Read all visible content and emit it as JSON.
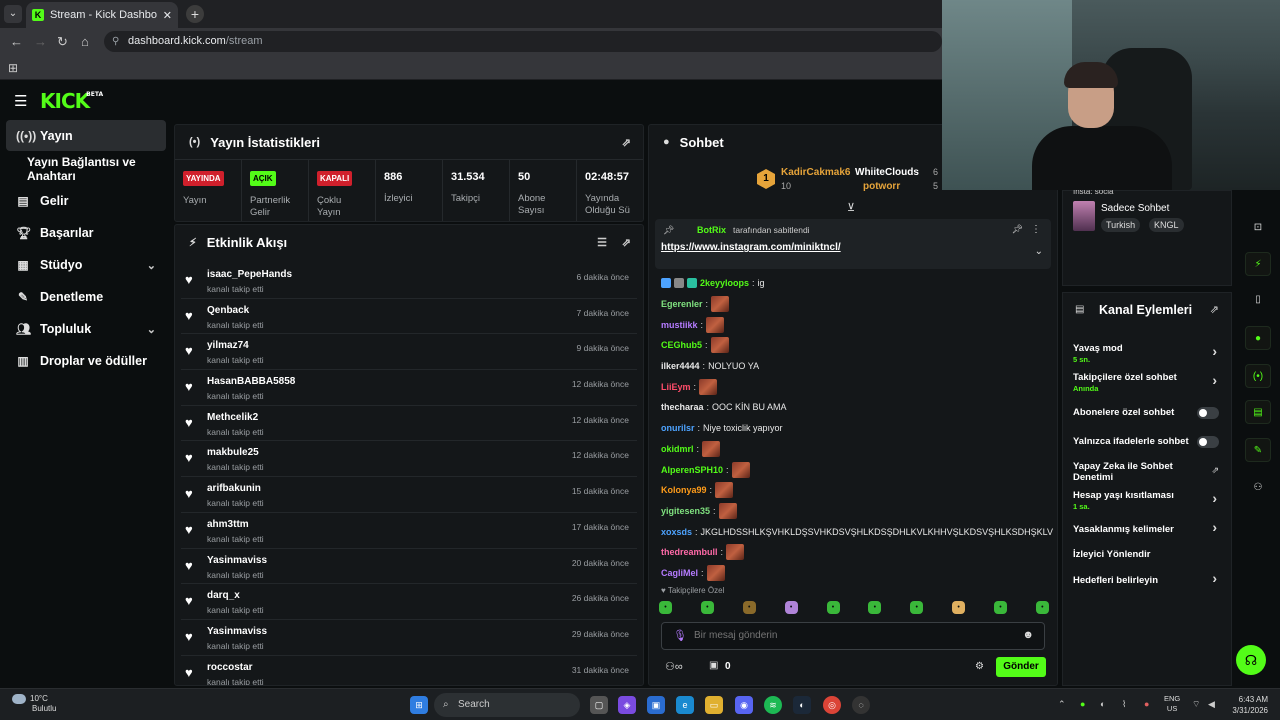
{
  "browser": {
    "tab_title": "Stream - Kick Dashboard",
    "url_host": "dashboard.kick.com",
    "url_path": "/stream"
  },
  "brand": {
    "logo": "KICK",
    "beta": "BETA"
  },
  "sidebar": {
    "items": [
      {
        "label": "Yayın",
        "icon": "broadcast-icon"
      },
      {
        "label": "Yayın Bağlantısı ve Anahtarı",
        "icon": ""
      },
      {
        "label": "Gelir",
        "icon": "revenue-icon"
      },
      {
        "label": "Başarılar",
        "icon": "trophy-icon"
      },
      {
        "label": "Stüdyo",
        "icon": "studio-icon"
      },
      {
        "label": "Denetleme",
        "icon": "wrench-icon"
      },
      {
        "label": "Topluluk",
        "icon": "community-icon"
      },
      {
        "label": "Droplar ve ödüller",
        "icon": "drops-icon"
      }
    ]
  },
  "stats_panel": {
    "title": "Yayın İstatistikleri",
    "stats": [
      {
        "badge": "YAYINDA",
        "label": "Yayın"
      },
      {
        "badge": "AÇIK",
        "label": "Partnerlik Gelir"
      },
      {
        "badge": "KAPALI",
        "label": "Çoklu Yayın"
      },
      {
        "value": "886",
        "label": "İzleyici"
      },
      {
        "value": "31.534",
        "label": "Takipçi"
      },
      {
        "value": "50",
        "label": "Abone Sayısı"
      },
      {
        "value": "02:48:57",
        "label": "Yayında Olduğu Sü"
      }
    ]
  },
  "event_panel": {
    "title": "Etkinlik Akışı",
    "events": [
      {
        "user": "isaac_PepeHands",
        "action": "kanalı takip etti",
        "time": "6 dakika önce"
      },
      {
        "user": "Qenback",
        "action": "kanalı takip etti",
        "time": "7 dakika önce"
      },
      {
        "user": "yilmaz74",
        "action": "kanalı takip etti",
        "time": "9 dakika önce"
      },
      {
        "user": "HasanBABBA5858",
        "action": "kanalı takip etti",
        "time": "12 dakika önce"
      },
      {
        "user": "Methcelik2",
        "action": "kanalı takip etti",
        "time": "12 dakika önce"
      },
      {
        "user": "makbule25",
        "action": "kanalı takip etti",
        "time": "12 dakika önce"
      },
      {
        "user": "arifbakunin",
        "action": "kanalı takip etti",
        "time": "15 dakika önce"
      },
      {
        "user": "ahm3ttm",
        "action": "kanalı takip etti",
        "time": "17 dakika önce"
      },
      {
        "user": "Yasinmaviss",
        "action": "kanalı takip etti",
        "time": "20 dakika önce"
      },
      {
        "user": "darq_x",
        "action": "kanalı takip etti",
        "time": "26 dakika önce"
      },
      {
        "user": "Yasinmaviss",
        "action": "kanalı takip etti",
        "time": "29 dakika önce"
      },
      {
        "user": "roccostar",
        "action": "kanalı takip etti",
        "time": "31 dakika önce"
      }
    ]
  },
  "chat": {
    "title": "Sohbet",
    "leaderboard": [
      {
        "rank": "1",
        "user": "KadirCakmak6",
        "count": "10"
      },
      {
        "user": "WhiiteClouds",
        "count": "6"
      },
      {
        "user": "potworr",
        "count": "5"
      }
    ],
    "pinned_by": "BotRix",
    "pinned_label": "tarafından sabitlendi",
    "pinned_link": "https://www.instagram.com/miniktncl/",
    "messages": [
      {
        "user": "2keyyloops",
        "color": "#53fc18",
        "text": "ig",
        "emote": false
      },
      {
        "user": "Egerenler",
        "color": "#7fe07f",
        "text": "",
        "emote": true
      },
      {
        "user": "mustiikk",
        "color": "#b57bff",
        "text": "",
        "emote": true
      },
      {
        "user": "CEGhub5",
        "color": "#53fc18",
        "text": "",
        "emote": true
      },
      {
        "user": "ilker4444",
        "color": "#e8e8e8",
        "text": "NOLYUO YA",
        "emote": false
      },
      {
        "user": "LiiEym",
        "color": "#ff4d6a",
        "text": "",
        "emote": true
      },
      {
        "user": "thecharaa",
        "color": "#e8e8e8",
        "text": "OOC KİN BU AMA",
        "emote": false
      },
      {
        "user": "onurilsr",
        "color": "#4da3ff",
        "text": "Niye toxiclik yapıyor",
        "emote": false
      },
      {
        "user": "okidmrl",
        "color": "#53fc18",
        "text": "",
        "emote": true
      },
      {
        "user": "AlperenSPH10",
        "color": "#53fc18",
        "text": "",
        "emote": true
      },
      {
        "user": "Kolonya99",
        "color": "#ff9c1a",
        "text": "",
        "emote": true
      },
      {
        "user": "yigitesen35",
        "color": "#7fe07f",
        "text": "",
        "emote": true
      },
      {
        "user": "xoxsds",
        "color": "#4da3ff",
        "text": "JKGLHDSSHLKŞVHKLDŞSVHKDSVŞHLKDSŞDHLKVLKHHVŞLKDSVŞHLKSDHŞKLV",
        "emote": false
      },
      {
        "user": "thedreambull",
        "color": "#ff6aa8",
        "text": "",
        "emote": true
      },
      {
        "user": "CagliMel",
        "color": "#b57bff",
        "text": "",
        "emote": true
      }
    ],
    "followers_only": "Takipçilere Özel",
    "input_placeholder": "Bir mesaj gönderin",
    "points": "0",
    "send_label": "Gönder"
  },
  "right_panel": {
    "partial_label": "Insta: socia",
    "mode": "Sadece Sohbet",
    "tags": [
      "Turkish",
      "KNGL"
    ]
  },
  "channel_actions": {
    "title": "Kanal Eylemleri",
    "items": [
      {
        "label": "Yavaş mod",
        "sub": "5 sn."
      },
      {
        "label": "Takipçilere özel sohbet",
        "sub": "Anında"
      },
      {
        "label": "Abonelere özel sohbet",
        "sub": ""
      },
      {
        "label": "Yalnızca ifadelerle sohbet",
        "sub": ""
      },
      {
        "label": "Yapay Zeka ile Sohbet Denetimi",
        "sub": ""
      },
      {
        "label": "Hesap yaşı kısıtlaması",
        "sub": "1 sa."
      },
      {
        "label": "Yasaklanmış kelimeler",
        "sub": ""
      },
      {
        "label": "İzleyici Yönlendir",
        "sub": ""
      },
      {
        "label": "Hedefleri belirleyin",
        "sub": ""
      }
    ]
  },
  "taskbar": {
    "temp": "10°C",
    "weather": "Bulutlu",
    "search_label": "Search",
    "lang": "ENG",
    "region": "US",
    "time": "6:43 AM",
    "date": "3/31/2026"
  },
  "colors": {
    "accent": "#53fc18",
    "bg": "#0b0e0f",
    "panel": "#141719",
    "live_red": "#d0202c"
  }
}
